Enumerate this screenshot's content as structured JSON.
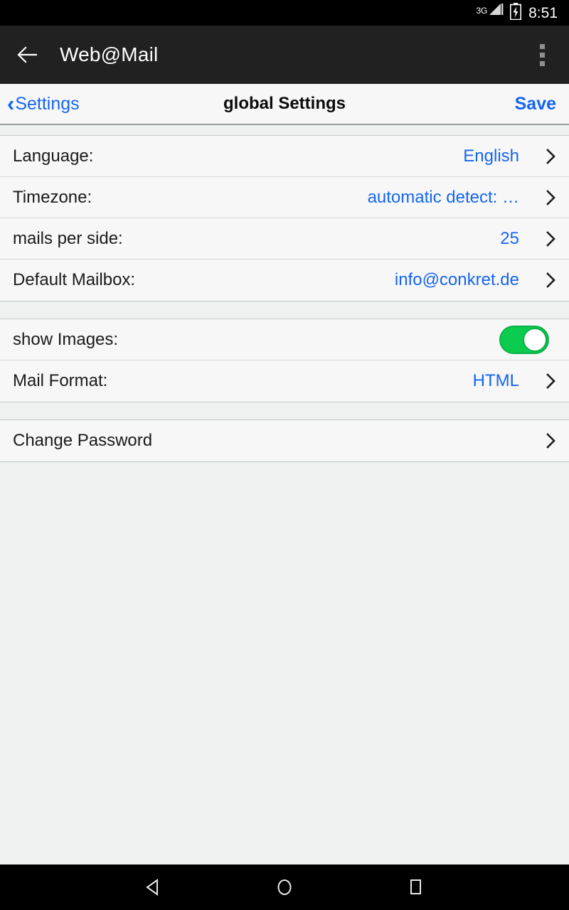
{
  "status_bar": {
    "network_label": "3G",
    "signal_icon": "signal-bars-icon",
    "battery_icon": "battery-charging-icon",
    "time": "8:51"
  },
  "app_bar": {
    "back_icon": "arrow-back-icon",
    "title": "Web@Mail",
    "overflow_icon": "overflow-menu-icon"
  },
  "nav_bar": {
    "back_chevron": "‹",
    "back_label": "Settings",
    "title": "global Settings",
    "save_label": "Save"
  },
  "settings": {
    "groups": [
      {
        "rows": [
          {
            "label": "Language:",
            "value": "English",
            "accessory": "chevron"
          },
          {
            "label": "Timezone:",
            "value": "automatic detect: …",
            "accessory": "chevron"
          },
          {
            "label": "mails per side:",
            "value": "25",
            "accessory": "chevron"
          },
          {
            "label": "Default Mailbox:",
            "value": "info@conkret.de",
            "accessory": "chevron"
          }
        ]
      },
      {
        "rows": [
          {
            "label": "show Images:",
            "value": "",
            "accessory": "toggle",
            "toggle_on": true
          },
          {
            "label": "Mail Format:",
            "value": "HTML",
            "accessory": "chevron"
          }
        ]
      },
      {
        "rows": [
          {
            "label": "Change Password",
            "value": "",
            "accessory": "chevron"
          }
        ]
      }
    ]
  },
  "system_nav": {
    "back_icon": "system-back-icon",
    "home_icon": "system-home-icon",
    "recents_icon": "system-recents-icon"
  },
  "colors": {
    "accent_blue": "#1565f0",
    "toggle_green": "#0ccc4f",
    "app_bar_dark": "#212121",
    "row_bg": "#f7f7f7",
    "page_bg": "#eff1f1"
  }
}
